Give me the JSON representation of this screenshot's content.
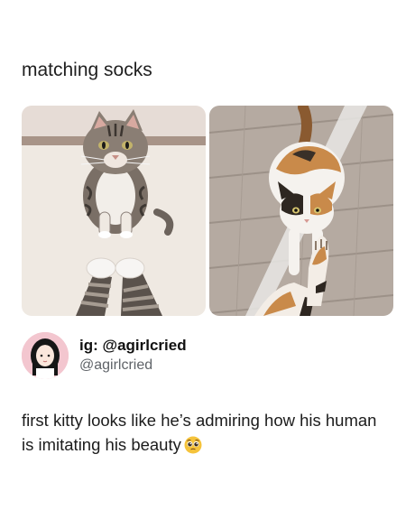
{
  "post": {
    "title": "matching socks",
    "author": {
      "display_name": "ig: @agirlcried",
      "handle": "@agirlcried"
    },
    "caption": "first kitty looks like he’s admiring how his human is imitating his beauty",
    "caption_emoji": "pleading-face-emoji"
  },
  "images": [
    {
      "subject": "tabby cat with grey striped socks"
    },
    {
      "subject": "calico cat with calico-pattern socks"
    }
  ],
  "colors": {
    "text": "#1f1f1f",
    "handle": "#5f6368",
    "avatar_bg": "#f3c6cf"
  }
}
